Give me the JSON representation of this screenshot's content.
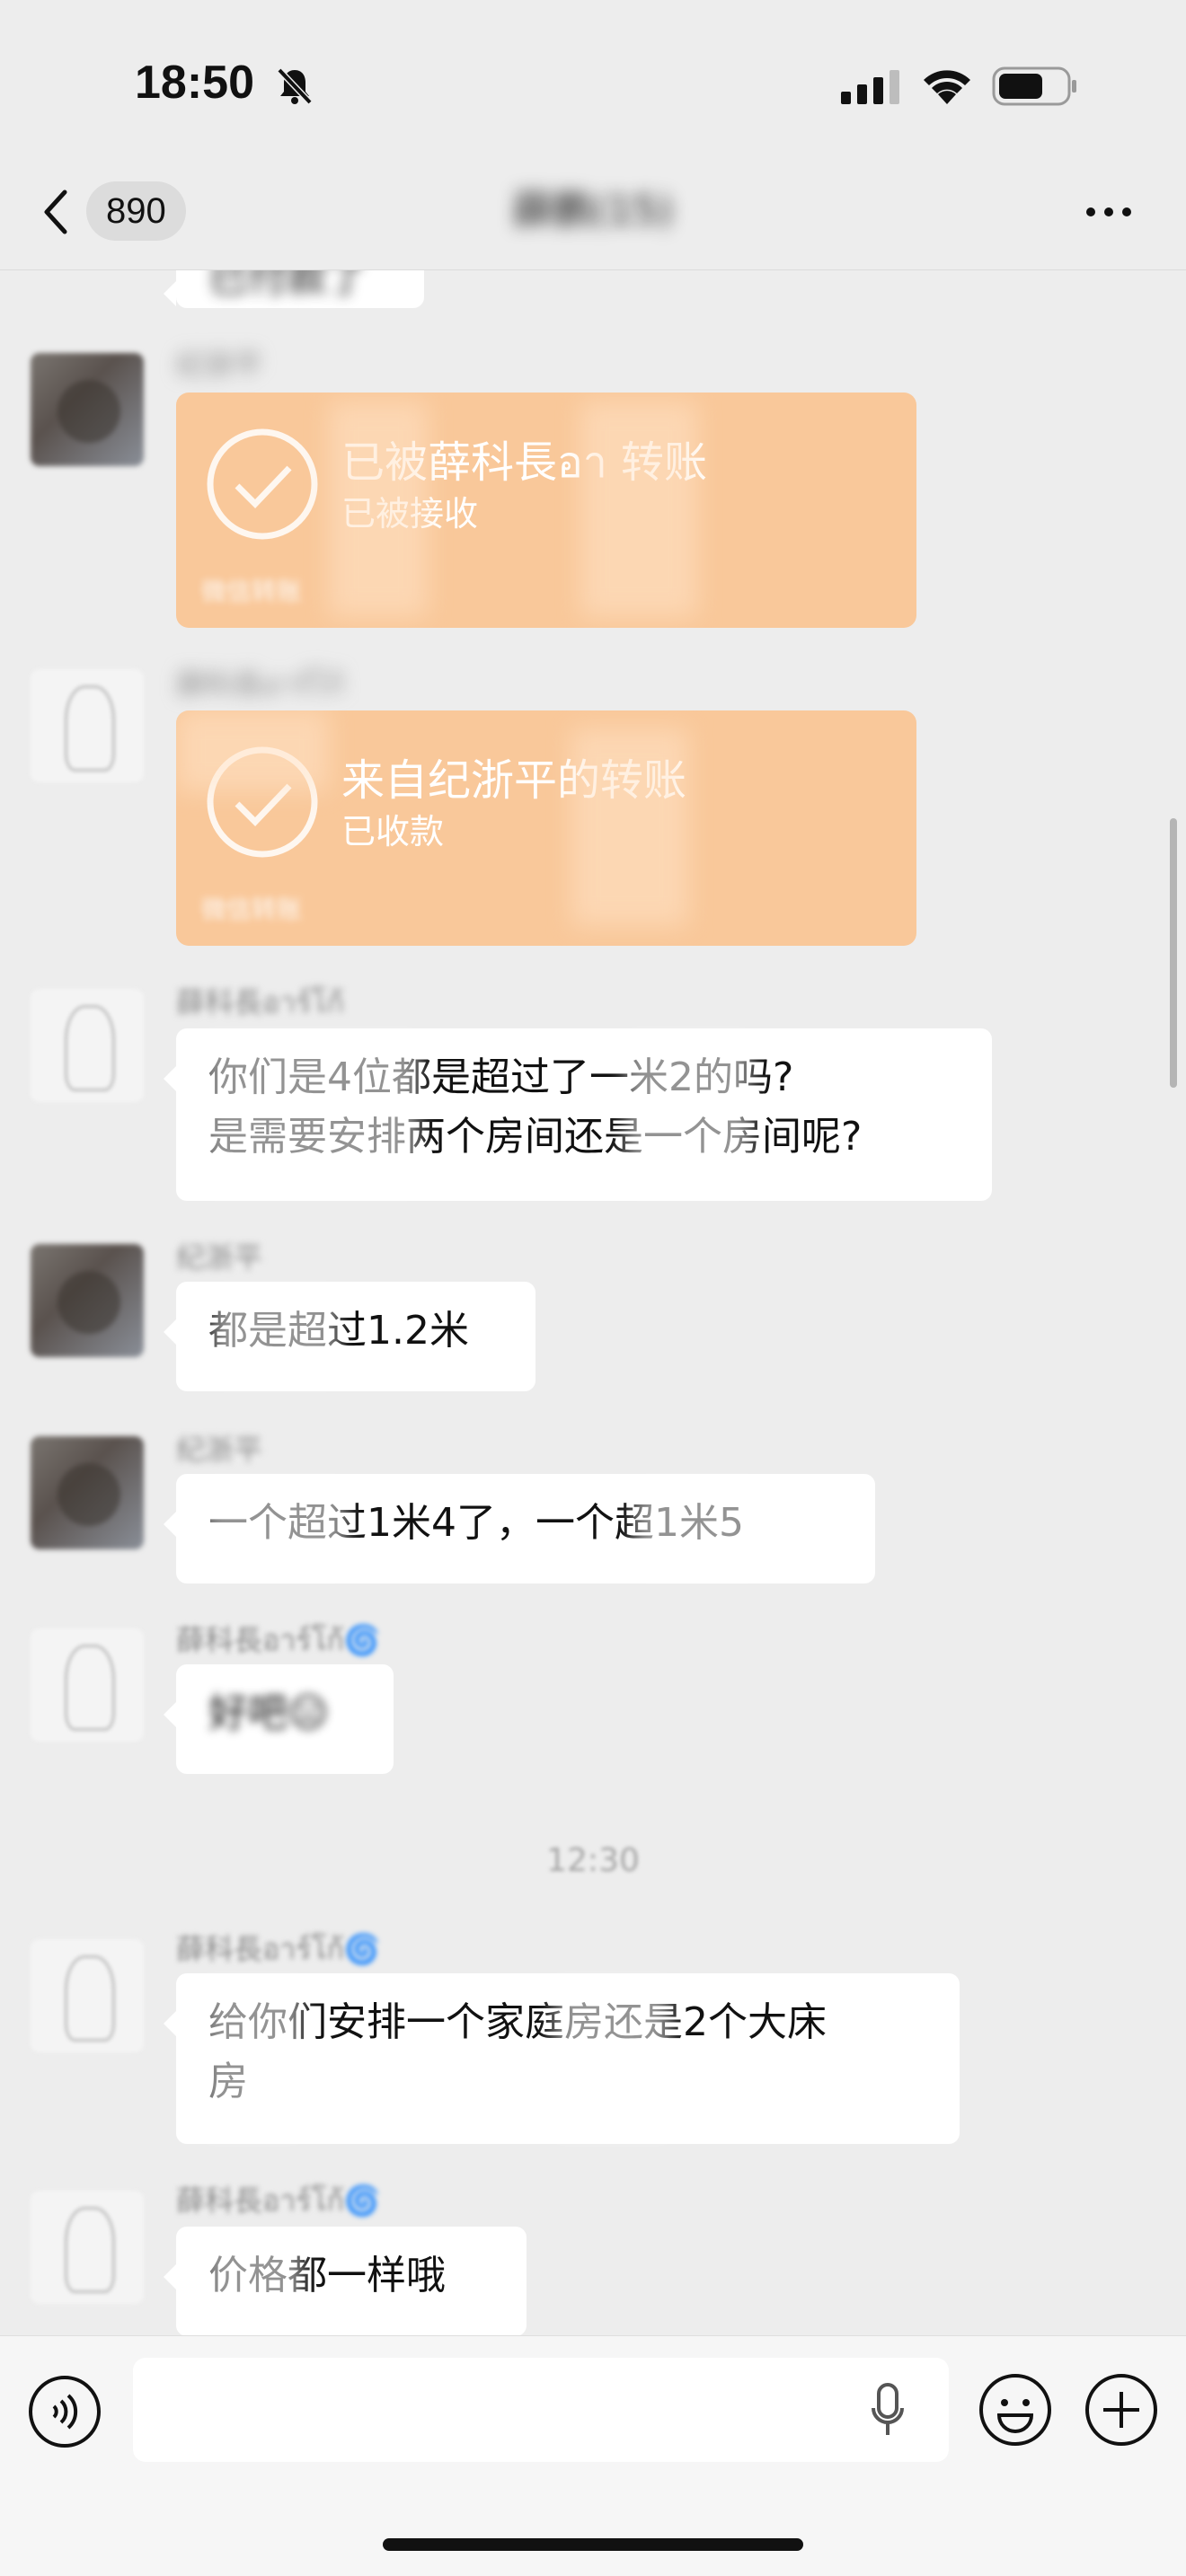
{
  "status_bar": {
    "time": "18:50"
  },
  "nav": {
    "unread_count": "890",
    "title": "薛鹏(15)"
  },
  "messages": [
    {
      "type": "text",
      "text": "已付款了"
    },
    {
      "type": "transfer",
      "sender": "纪浙平",
      "title": "已被薛科長อา 转账",
      "subtitle": "已被接收",
      "footer": "微信转账"
    },
    {
      "type": "transfer",
      "sender": "薛科長อาร์โก้",
      "title": "来自纪浙平的转账",
      "subtitle": "已收款",
      "footer": "微信转账"
    },
    {
      "type": "text",
      "sender": "薛科長อาร์โก้",
      "lines": [
        "你们是4位都是超过了一米2的吗?",
        "是需要安排两个房间还是一个房间呢?"
      ]
    },
    {
      "type": "text",
      "sender": "纪浙平",
      "text": "都是超过1.2米"
    },
    {
      "type": "text",
      "sender": "纪浙平",
      "text": "一个超过1米4了，一个超1米5"
    },
    {
      "type": "text",
      "sender": "薛科長อาร์โก้🌀",
      "text": "好吧😑"
    },
    {
      "type": "time",
      "text": "12:30"
    },
    {
      "type": "text",
      "sender": "薛科長อาร์โก้🌀",
      "lines": [
        "给你们安排一个家庭房还是2个大床",
        "房"
      ]
    },
    {
      "type": "text",
      "sender": "薛科長อาร์โก้🌀",
      "text": "价格都一样哦"
    }
  ],
  "icons": {
    "back": "chevron-left-icon",
    "more": "ellipsis-icon",
    "voice": "voice-icon",
    "mic": "mic-icon",
    "emoji": "emoji-icon",
    "plus": "plus-icon",
    "transfer_check": "check-circle-icon"
  },
  "colors": {
    "background": "#ededed",
    "bubble": "#ffffff",
    "transfer_card": "#f9c89a"
  }
}
